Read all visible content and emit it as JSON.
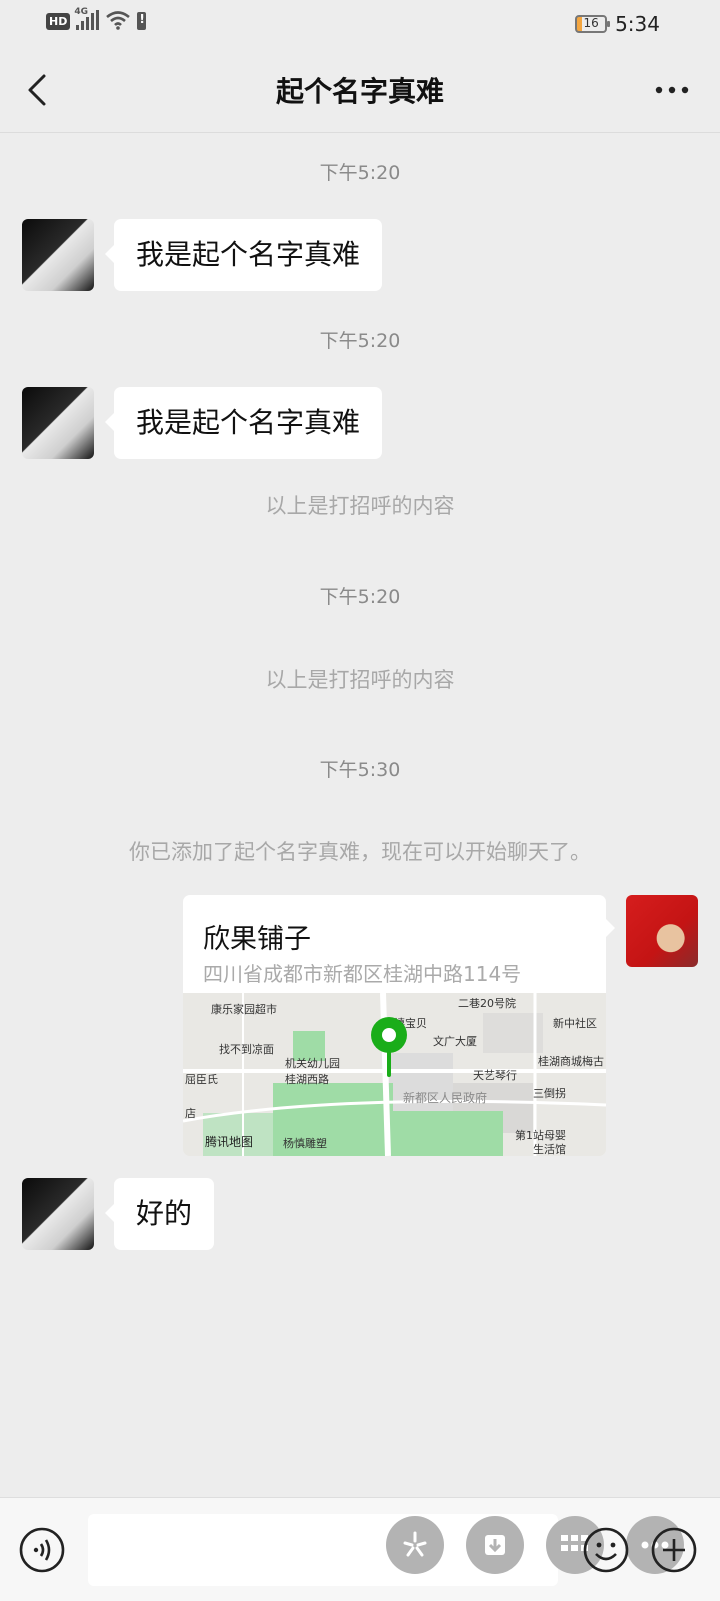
{
  "status_bar": {
    "network": "HD",
    "signal_label": "4G",
    "battery": "16",
    "time": "5:34"
  },
  "header": {
    "title": "起个名字真难"
  },
  "messages": [
    {
      "time": "下午5:20",
      "text": "我是起个名字真难"
    },
    {
      "time": "下午5:20",
      "text": "我是起个名字真难"
    },
    {
      "system": "以上是打招呼的内容"
    },
    {
      "time": "下午5:20"
    },
    {
      "system": "以上是打招呼的内容"
    },
    {
      "time": "下午5:30"
    },
    {
      "system": "你已添加了起个名字真难，现在可以开始聊天了。"
    },
    {
      "location": {
        "name": "欣果铺子",
        "address": "四川省成都市新都区桂湖中路114号"
      }
    },
    {
      "text": "好的"
    }
  ],
  "map": {
    "labels": [
      "康乐家园超市",
      "二巷20号院",
      "新中社区",
      "千禧宝贝",
      "文广大厦",
      "找不到凉面",
      "机关幼儿园",
      "桂湖商城梅古",
      "屈臣氏",
      "桂湖西路",
      "天艺琴行",
      "三倒拐",
      "新都区人民政府",
      "店",
      "第1站母婴",
      "生活馆",
      "杨慎雕塑",
      "腾讯地图"
    ]
  },
  "colors": {
    "chat_bg": "#ededed",
    "bubble": "#ffffff",
    "pin": "#1aad19",
    "system_text": "#a8a8a8"
  }
}
